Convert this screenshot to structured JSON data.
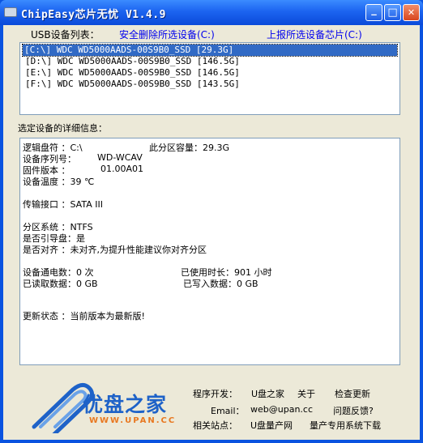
{
  "window": {
    "title": "ChipEasy芯片无忧 V1.4.9",
    "buttons": {
      "minimize": "_",
      "maximize": "□",
      "close": "✕"
    }
  },
  "toolbar": {
    "usb_list_label": "USB设备列表：",
    "safe_remove": "安全删除所选设备(C:)",
    "report_chip": "上报所选设备芯片(C:)"
  },
  "devices": [
    "[C:\\] WDC WD5000AADS-00S9B0_SSD [29.3G]",
    "[D:\\] WDC WD5000AADS-00S9B0_SSD [146.5G]",
    "[E:\\] WDC WD5000AADS-00S9B0_SSD [146.5G]",
    "[F:\\] WDC WD5000AADS-00S9B0_SSD [143.5G]"
  ],
  "details": {
    "section_label": "选定设备的详细信息：",
    "logical_drive": "逻辑盘符  ：C:\\",
    "partition_capacity": "此分区容量：29.3G",
    "serial": "设备序列号：",
    "serial_value": "WD-WCAV",
    "firmware": "固件版本  ：",
    "firmware_value": "01.00A01",
    "temperature": "设备温度  ：39 ℃",
    "interface": "传输接口  ：SATA III",
    "filesystem": "分区系统  ：NTFS",
    "boot_disk": "是否引导盘：是",
    "aligned": "是否对齐  ：未对齐,为提升性能建议你对齐分区",
    "power_count": "设备通电数：0 次",
    "used_hours": "已使用时长：901 小时",
    "read_data": "已读取数据：0 GB",
    "written_data": "已写入数据：0 GB",
    "update_status": "更新状态  ：当前版本为最新版!"
  },
  "footer": {
    "logo_main": "优盘之家",
    "logo_url": "WWW.UPAN.CC",
    "developer_label": "程序开发：",
    "developer_value": "U盘之家",
    "about": "关于",
    "check_update": "检查更新",
    "email_label": "Email：",
    "email_value": "web@upan.cc",
    "feedback": "问题反馈?",
    "related_label": "相关站点：",
    "related_site": "U盘量产网",
    "mass_download": "量产专用系统下载"
  },
  "colors": {
    "title_blue": "#0b4ad9",
    "selection": "#316ac5",
    "link": "#0000ee",
    "logo_blue": "#1e62c8",
    "logo_orange": "#e87820"
  }
}
